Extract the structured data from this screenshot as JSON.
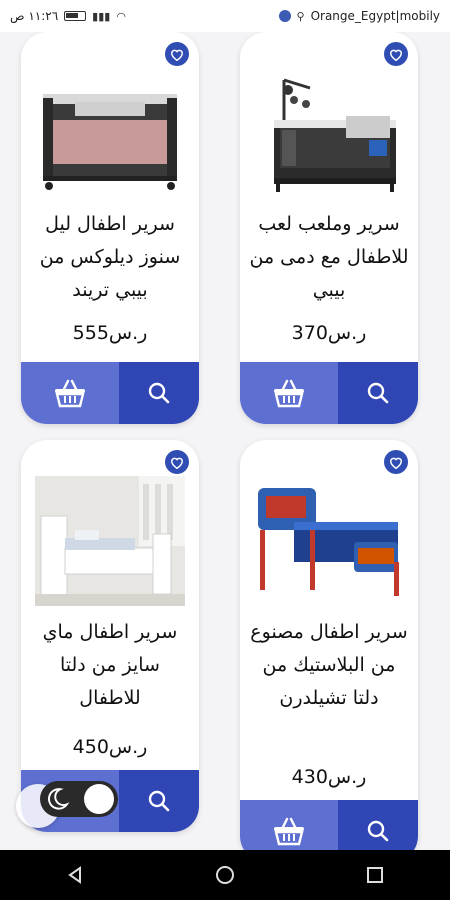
{
  "status_bar": {
    "time": "١١:٢٦ ص",
    "carrier": "Orange_Egypt|mobily",
    "network_left": "LTE",
    "network_right": "4G"
  },
  "products": [
    {
      "title": "سرير وملعب لعب للاطفال مع دمى من بيبي",
      "price": "ر.س370",
      "image": "crib-with-mobile-image"
    },
    {
      "title": "سرير اطفال ليل سنوز ديلوكس من بيبي تريند",
      "price": "ر.س555",
      "image": "travel-crib-image"
    },
    {
      "title": "سرير اطفال مصنوع من البلاستيك من دلتا تشيلدرن",
      "price": "ر.س430",
      "image": "cars-toddler-bed-image"
    },
    {
      "title": "سرير اطفال ماي سايز من دلتا للاطفال",
      "price": "ر.س450",
      "image": "white-toddler-bed-image"
    }
  ],
  "icons": {
    "favorite": "heart-icon",
    "search": "search-icon",
    "cart": "basket-icon",
    "theme": "moon-icon"
  },
  "colors": {
    "accent_dark": "#3046b5",
    "accent_light": "#5d6fd0",
    "favorite": "#2f4db3"
  }
}
